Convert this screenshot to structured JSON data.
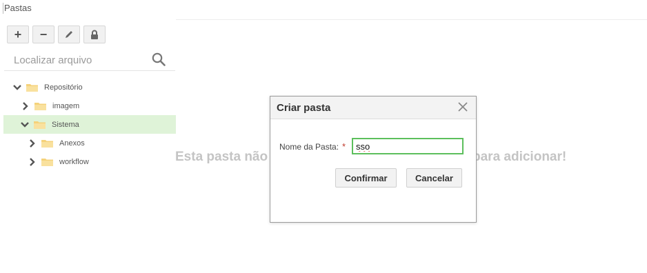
{
  "panel": {
    "title": "Pastas"
  },
  "toolbar": {
    "buttons": [
      {
        "icon": "plus-icon",
        "glyph": "+"
      },
      {
        "icon": "minus-icon",
        "glyph": "−"
      },
      {
        "icon": "pencil-icon"
      },
      {
        "icon": "lock-icon"
      }
    ]
  },
  "search": {
    "placeholder": "Localizar arquivo",
    "value": ""
  },
  "tree": {
    "items": [
      {
        "label": "Repositório",
        "expanded": true,
        "level": 0
      },
      {
        "label": "imagem",
        "expanded": false,
        "level": 1
      },
      {
        "label": "Sistema",
        "expanded": true,
        "level": 1,
        "selected": true
      },
      {
        "label": "Anexos",
        "expanded": false,
        "level": 2
      },
      {
        "label": "workflow",
        "expanded": false,
        "level": 2
      }
    ]
  },
  "empty": {
    "left": "Esta pasta não",
    "right": "para adicionar!"
  },
  "dialog": {
    "title": "Criar pasta",
    "field_label": "Nome da Pasta:",
    "required_mark": "*",
    "field_value": "sso",
    "confirm": "Confirmar",
    "cancel": "Cancelar"
  },
  "colors": {
    "selected_bg": "#dff3d8",
    "folder": "#f5d27a",
    "input_border": "#5cbf5c",
    "required": "#c0392b"
  }
}
